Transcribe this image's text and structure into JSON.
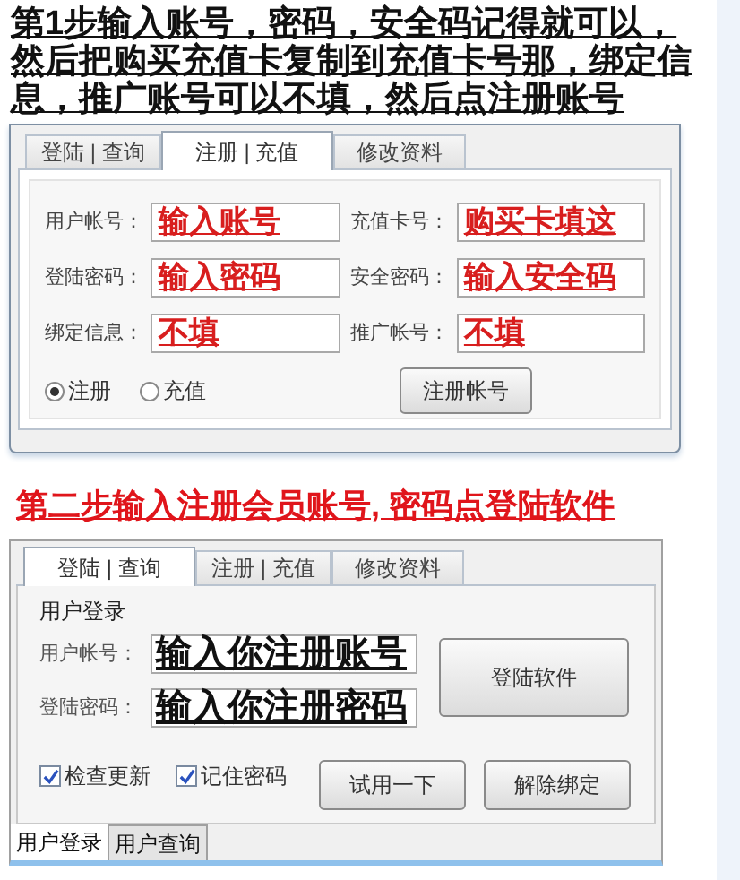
{
  "step1": {
    "heading": "第1步输入账号，密码，安全码记得就可以，然后把购买充值卡复制到充值卡号那，绑定信息，推广账号可以不填，然后点注册账号",
    "window": {
      "tabs": [
        {
          "label": "登陆 | 查询",
          "selected": false
        },
        {
          "label": "注册 | 充值",
          "selected": true
        },
        {
          "label": "修改资料",
          "selected": false
        }
      ],
      "fields": [
        {
          "label": "用户帐号：",
          "value": "输入账号"
        },
        {
          "label": "充值卡号：",
          "value": "购买卡填这"
        },
        {
          "label": "登陆密码：",
          "value": "输入密码"
        },
        {
          "label": "安全密码：",
          "value": "输入安全码"
        },
        {
          "label": "绑定信息：",
          "value": "不填"
        },
        {
          "label": "推广帐号：",
          "value": "不填"
        }
      ],
      "radios": [
        {
          "label": "注册",
          "selected": true
        },
        {
          "label": "充值",
          "selected": false
        }
      ],
      "button": "注册帐号"
    }
  },
  "step2": {
    "heading": "第二步输入注册会员账号, 密码点登陆软件",
    "window": {
      "tabs": [
        {
          "label": "登陆 | 查询",
          "selected": true
        },
        {
          "label": "注册 | 充值",
          "selected": false
        },
        {
          "label": "修改资料",
          "selected": false
        }
      ],
      "group_title": "用户登录",
      "fields": [
        {
          "label": "用户帐号：",
          "value": "输入你注册账号"
        },
        {
          "label": "登陆密码：",
          "value": "输入你注册密码"
        }
      ],
      "login_button": "登陆软件",
      "checkboxes": [
        {
          "label": "检查更新",
          "checked": true
        },
        {
          "label": "记住密码",
          "checked": true
        }
      ],
      "buttons": [
        "试用一下",
        "解除绑定"
      ],
      "bottom_tabs": [
        {
          "label": "用户登录",
          "selected": true
        },
        {
          "label": "用户查询",
          "selected": false
        }
      ]
    }
  }
}
